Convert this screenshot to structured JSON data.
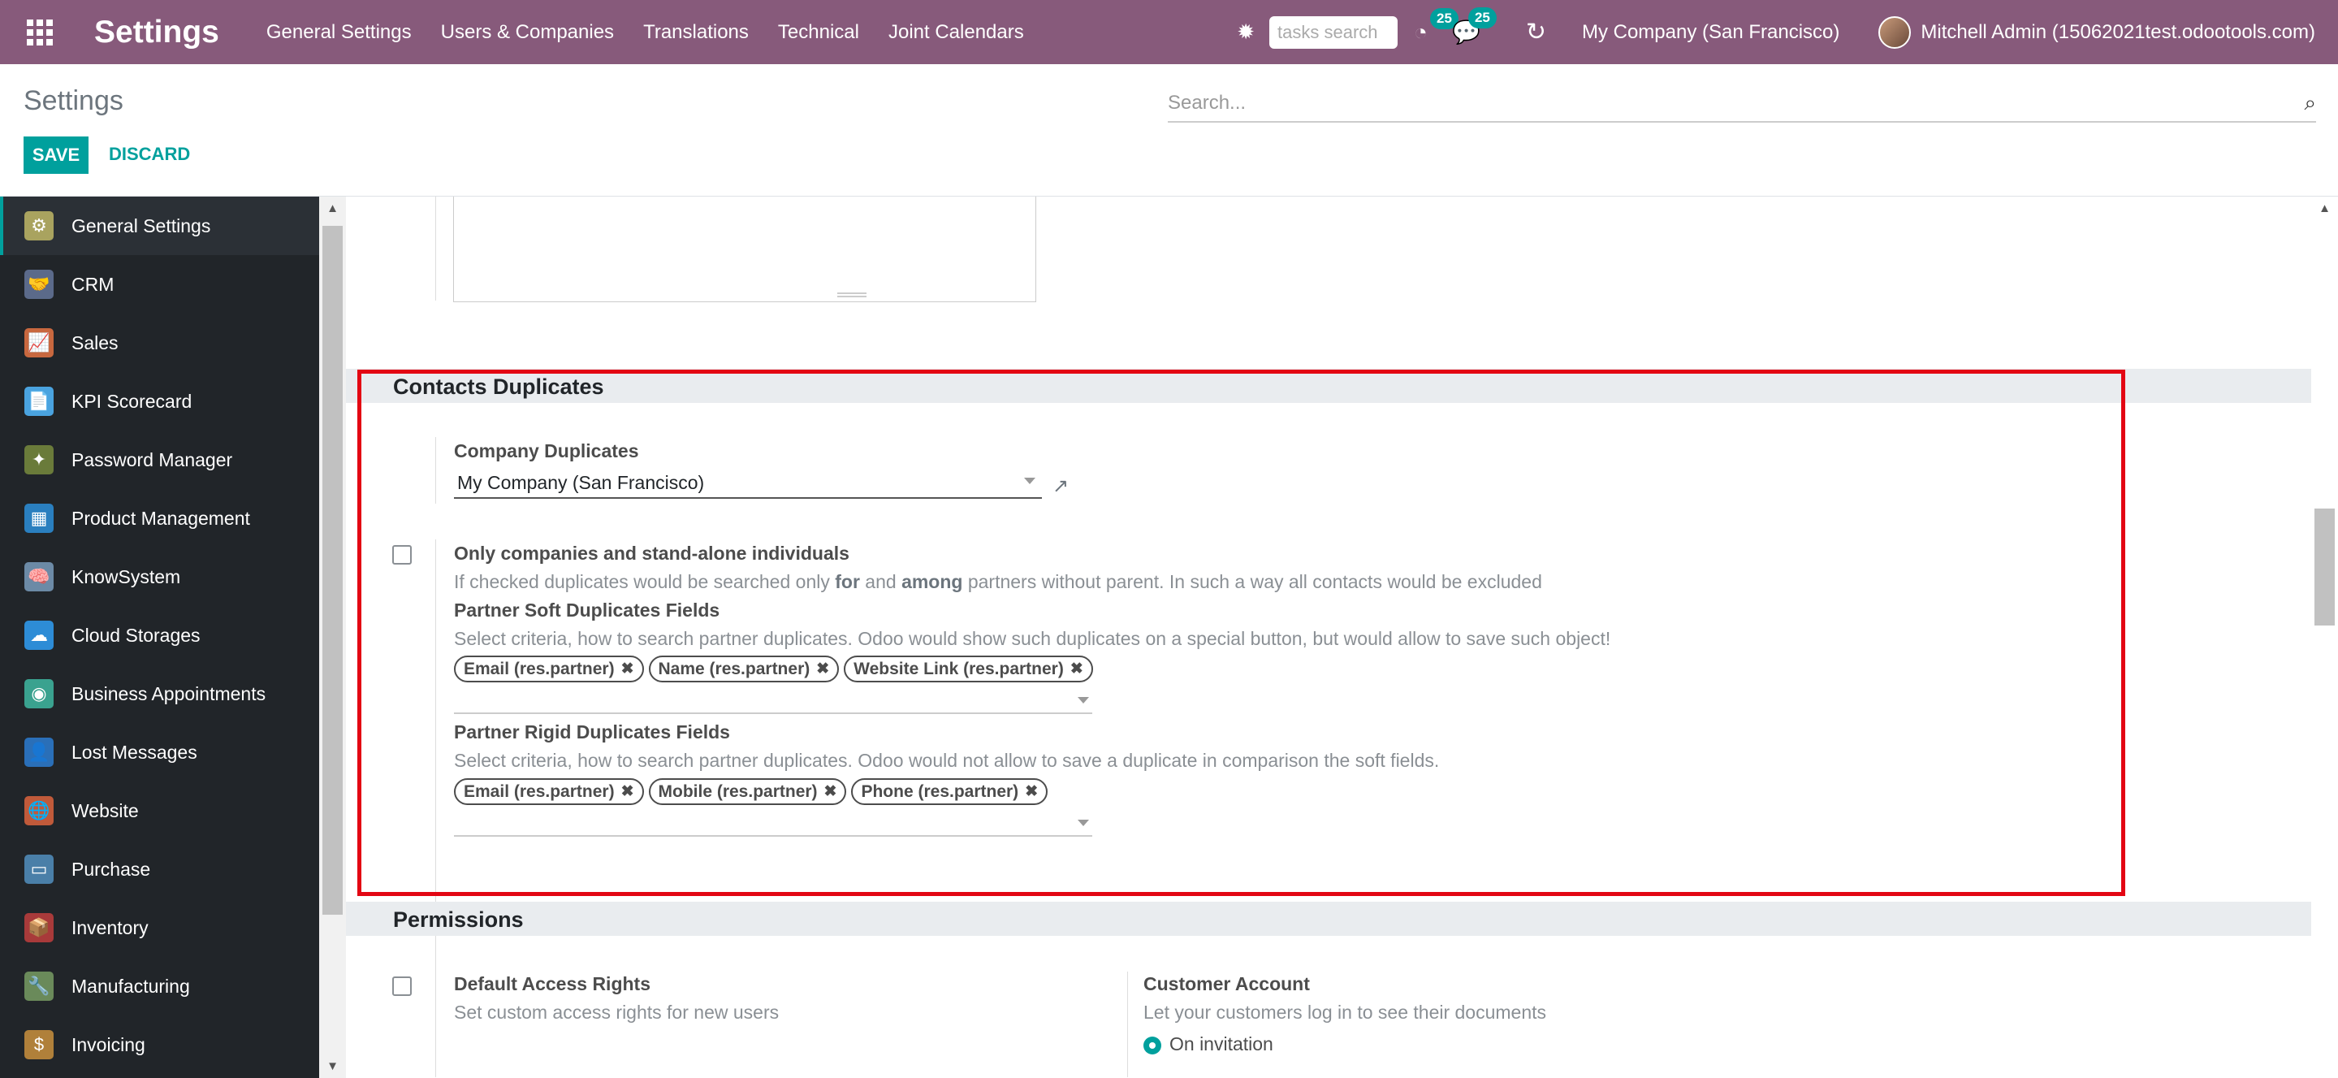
{
  "navbar": {
    "brand": "Settings",
    "menu": [
      "General Settings",
      "Users & Companies",
      "Translations",
      "Technical",
      "Joint Calendars"
    ],
    "tasks_placeholder": "tasks search",
    "activity_count": "25",
    "messages_count": "25",
    "company": "My Company (San Francisco)",
    "user": "Mitchell Admin (15062021test.odootools.com)",
    "icons": [
      "apps-grid-icon",
      "bug-icon",
      "activity-clock-icon",
      "chat-icon",
      "sync-icon"
    ]
  },
  "control_panel": {
    "title": "Settings",
    "search_placeholder": "Search...",
    "save_label": "SAVE",
    "discard_label": "DISCARD"
  },
  "sidebar": {
    "items": [
      {
        "label": "General Settings",
        "color": "#a9a35f",
        "glyph": "⚙"
      },
      {
        "label": "CRM",
        "color": "#5b6a8a",
        "glyph": "🤝"
      },
      {
        "label": "Sales",
        "color": "#c8683f",
        "glyph": "📈"
      },
      {
        "label": "KPI Scorecard",
        "color": "#4aa3df",
        "glyph": "📄"
      },
      {
        "label": "Password Manager",
        "color": "#6a7b3a",
        "glyph": "✦"
      },
      {
        "label": "Product Management",
        "color": "#2a7fbf",
        "glyph": "▦"
      },
      {
        "label": "KnowSystem",
        "color": "#6c8aa6",
        "glyph": "🧠"
      },
      {
        "label": "Cloud Storages",
        "color": "#2d8cd6",
        "glyph": "☁"
      },
      {
        "label": "Business Appointments",
        "color": "#3aa28f",
        "glyph": "◉"
      },
      {
        "label": "Lost Messages",
        "color": "#2a6fb8",
        "glyph": "👤"
      },
      {
        "label": "Website",
        "color": "#c05a3a",
        "glyph": "🌐"
      },
      {
        "label": "Purchase",
        "color": "#4a7fa8",
        "glyph": "▭"
      },
      {
        "label": "Inventory",
        "color": "#a83a3a",
        "glyph": "📦"
      },
      {
        "label": "Manufacturing",
        "color": "#6a8a5a",
        "glyph": "🔧"
      },
      {
        "label": "Invoicing",
        "color": "#b0803a",
        "glyph": "$"
      }
    ]
  },
  "contacts_duplicates": {
    "heading": "Contacts Duplicates",
    "company_label": "Company Duplicates",
    "company_value": "My Company (San Francisco)",
    "only_companies_label": "Only companies and stand-alone individuals",
    "only_companies_help_1": "If checked duplicates would be searched only ",
    "only_companies_help_for": "for",
    "only_companies_help_and": " and ",
    "only_companies_help_among": "among",
    "only_companies_help_2": " partners without parent. In such a way all contacts would be excluded",
    "soft_label": "Partner Soft Duplicates Fields",
    "soft_help": "Select criteria, how to search partner duplicates. Odoo would show such duplicates on a special button, but would allow to save such object!",
    "soft_tags": [
      "Email (res.partner)",
      "Name (res.partner)",
      "Website Link (res.partner)"
    ],
    "rigid_label": "Partner Rigid Duplicates Fields",
    "rigid_help": "Select criteria, how to search partner duplicates. Odoo would not allow to save a duplicate in comparison the soft fields.",
    "rigid_tags": [
      "Email (res.partner)",
      "Mobile (res.partner)",
      "Phone (res.partner)"
    ]
  },
  "permissions": {
    "heading": "Permissions",
    "default_access_label": "Default Access Rights",
    "default_access_help": "Set custom access rights for new users",
    "customer_account_label": "Customer Account",
    "customer_account_help": "Let your customers log in to see their documents",
    "customer_account_option": "On invitation"
  },
  "colors": {
    "navbar": "#875a7b",
    "accent": "#00a09d",
    "highlight": "#e30613",
    "sidebar": "#212529"
  }
}
